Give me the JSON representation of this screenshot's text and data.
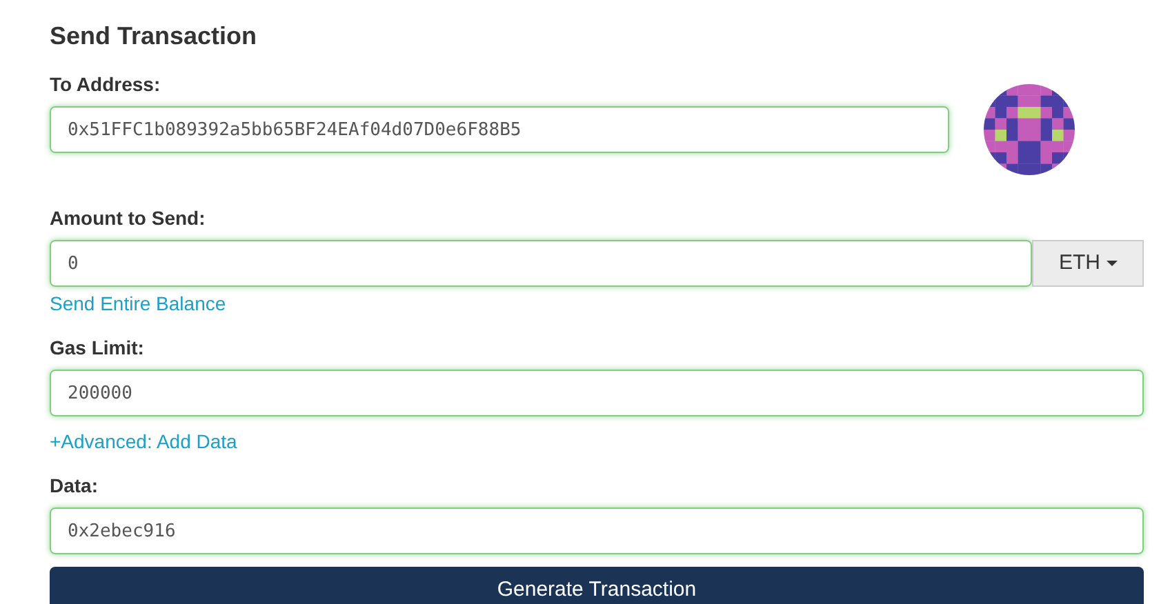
{
  "title": "Send Transaction",
  "fields": [
    {
      "kind": "address",
      "label": "To Address:",
      "value": "0x51FFC1b089392a5bb65BF24EAf04d07D0e6F88B5",
      "valid": true
    },
    {
      "kind": "amount",
      "label": "Amount to Send:",
      "value": "0",
      "valid": true,
      "unit": "ETH",
      "link": "Send Entire Balance"
    },
    {
      "kind": "plain",
      "label": "Gas Limit:",
      "value": "200000",
      "valid": true,
      "link": "+Advanced: Add Data"
    },
    {
      "kind": "plain",
      "label": "Data:",
      "value": "0x2ebec916",
      "valid": true
    }
  ],
  "submit": "Generate Transaction"
}
